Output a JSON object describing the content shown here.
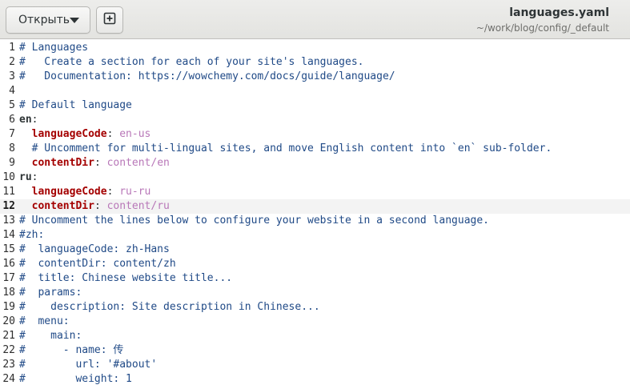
{
  "header": {
    "open_button_label": "Открыть",
    "new_tab_icon": "new-tab-icon",
    "title": "languages.yaml",
    "subtitle": "~/work/blog/config/_default"
  },
  "colors": {
    "comment": "#204a87",
    "key": "#a40000",
    "value": "#b877b8",
    "current_line": "#f3f3f3"
  },
  "editor": {
    "current_line": 12,
    "lines": [
      {
        "n": "1",
        "tokens": [
          {
            "t": "comment",
            "v": "# Languages"
          }
        ]
      },
      {
        "n": "2",
        "tokens": [
          {
            "t": "comment",
            "v": "#   Create a section for each of your site's languages."
          }
        ]
      },
      {
        "n": "3",
        "tokens": [
          {
            "t": "comment",
            "v": "#   Documentation: https://wowchemy.com/docs/guide/language/"
          }
        ]
      },
      {
        "n": "4",
        "tokens": []
      },
      {
        "n": "5",
        "tokens": [
          {
            "t": "comment",
            "v": "# Default language"
          }
        ]
      },
      {
        "n": "6",
        "tokens": [
          {
            "t": "top",
            "v": "en"
          },
          {
            "t": "punct",
            "v": ":"
          }
        ]
      },
      {
        "n": "7",
        "tokens": [
          {
            "t": "punct",
            "v": "  "
          },
          {
            "t": "key",
            "v": "languageCode"
          },
          {
            "t": "punct",
            "v": ": "
          },
          {
            "t": "value",
            "v": "en-us"
          }
        ]
      },
      {
        "n": "8",
        "tokens": [
          {
            "t": "punct",
            "v": "  "
          },
          {
            "t": "comment",
            "v": "# Uncomment for multi-lingual sites, and move English content into `en` sub-folder."
          }
        ]
      },
      {
        "n": "9",
        "tokens": [
          {
            "t": "punct",
            "v": "  "
          },
          {
            "t": "key",
            "v": "contentDir"
          },
          {
            "t": "punct",
            "v": ": "
          },
          {
            "t": "value",
            "v": "content/en"
          }
        ]
      },
      {
        "n": "10",
        "tokens": [
          {
            "t": "top",
            "v": "ru"
          },
          {
            "t": "punct",
            "v": ":"
          }
        ]
      },
      {
        "n": "11",
        "tokens": [
          {
            "t": "punct",
            "v": "  "
          },
          {
            "t": "key",
            "v": "languageCode"
          },
          {
            "t": "punct",
            "v": ": "
          },
          {
            "t": "value",
            "v": "ru-ru"
          }
        ]
      },
      {
        "n": "12",
        "tokens": [
          {
            "t": "punct",
            "v": "  "
          },
          {
            "t": "key",
            "v": "contentDir"
          },
          {
            "t": "punct",
            "v": ": "
          },
          {
            "t": "value",
            "v": "content/ru"
          }
        ]
      },
      {
        "n": "13",
        "tokens": [
          {
            "t": "comment",
            "v": "# Uncomment the lines below to configure your website in a second language."
          }
        ]
      },
      {
        "n": "14",
        "tokens": [
          {
            "t": "comment",
            "v": "#zh:"
          }
        ]
      },
      {
        "n": "15",
        "tokens": [
          {
            "t": "comment",
            "v": "#  languageCode: zh-Hans"
          }
        ]
      },
      {
        "n": "16",
        "tokens": [
          {
            "t": "comment",
            "v": "#  contentDir: content/zh"
          }
        ]
      },
      {
        "n": "17",
        "tokens": [
          {
            "t": "comment",
            "v": "#  title: Chinese website title..."
          }
        ]
      },
      {
        "n": "18",
        "tokens": [
          {
            "t": "comment",
            "v": "#  params:"
          }
        ]
      },
      {
        "n": "19",
        "tokens": [
          {
            "t": "comment",
            "v": "#    description: Site description in Chinese..."
          }
        ]
      },
      {
        "n": "20",
        "tokens": [
          {
            "t": "comment",
            "v": "#  menu:"
          }
        ]
      },
      {
        "n": "21",
        "tokens": [
          {
            "t": "comment",
            "v": "#    main:"
          }
        ]
      },
      {
        "n": "22",
        "tokens": [
          {
            "t": "comment",
            "v": "#      - name: 传"
          }
        ]
      },
      {
        "n": "23",
        "tokens": [
          {
            "t": "comment",
            "v": "#        url: '#about'"
          }
        ]
      },
      {
        "n": "24",
        "tokens": [
          {
            "t": "comment",
            "v": "#        weight: 1"
          }
        ]
      }
    ]
  }
}
